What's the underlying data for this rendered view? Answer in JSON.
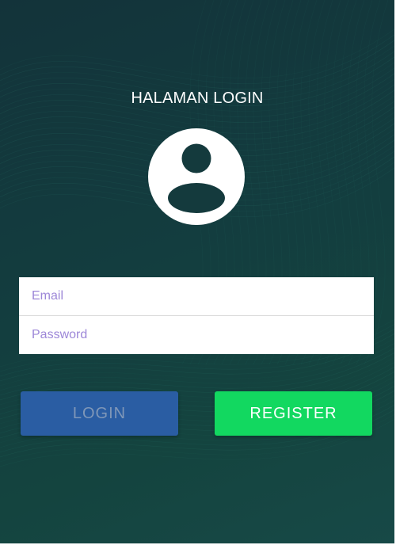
{
  "page": {
    "title": "HALAMAN LOGIN"
  },
  "form": {
    "email_placeholder": "Email",
    "password_placeholder": "Password"
  },
  "buttons": {
    "login_label": "LOGIN",
    "register_label": "REGISTER"
  },
  "colors": {
    "background": "#143a3d",
    "login_button": "#2a5da3",
    "register_button": "#12d860",
    "placeholder": "#9d87d8"
  },
  "icons": {
    "avatar": "user-circle-icon"
  }
}
